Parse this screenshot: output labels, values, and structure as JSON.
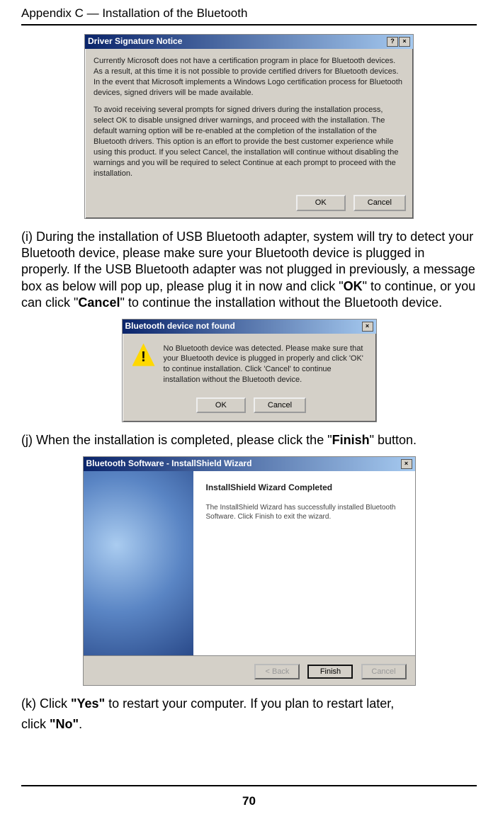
{
  "header": {
    "title": "Appendix C — Installation of the Bluetooth"
  },
  "dialog1": {
    "title": "Driver Signature Notice",
    "p1": "Currently Microsoft does not have a certification program in place for Bluetooth devices. As a result, at this time it is not possible to provide certified drivers for Bluetooth devices. In the event that Microsoft implements a Windows Logo certification process for Bluetooth devices, signed drivers will be made available.",
    "p2": "To avoid receiving several prompts for signed drivers during the installation process, select OK to disable unsigned driver warnings, and proceed with the installation. The default warning option will be re-enabled at the completion of the installation of the Bluetooth drivers. This option is an effort to provide the best customer experience while using this product. If you select Cancel, the installation will continue without disabling the warnings and you will be required to select Continue at each prompt to proceed with the installation.",
    "ok": "OK",
    "cancel": "Cancel"
  },
  "para_i": {
    "pre": "(i) During the installation of USB Bluetooth adapter, system will try to detect your Bluetooth device, please make sure your Bluetooth device is plugged in properly. If the USB Bluetooth adapter was not plugged in previously, a message box as below will pop up, please plug it in now and click \"",
    "ok": "OK",
    "mid": "\" to continue, or you can click \"",
    "cancel": "Cancel",
    "post": "\" to continue the installation without the Bluetooth device."
  },
  "dialog2": {
    "title": "Bluetooth device not found",
    "msg": "No Bluetooth device was detected. Please make sure that your Bluetooth device is plugged in properly and click 'OK' to continue installation. Click 'Cancel' to continue installation without the Bluetooth device.",
    "ok": "OK",
    "cancel": "Cancel"
  },
  "para_j": {
    "pre": "(j) When the installation is completed, please click the \"",
    "finish": "Finish",
    "post": "\" button."
  },
  "dialog3": {
    "title": "Bluetooth Software - InstallShield Wizard",
    "heading": "InstallShield Wizard Completed",
    "msg": "The InstallShield Wizard has successfully installed Bluetooth Software. Click Finish to exit the wizard.",
    "back": "< Back",
    "finish": "Finish",
    "cancel": "Cancel"
  },
  "para_k": {
    "pre": "(k) Click ",
    "yes": "\"Yes\"",
    "mid": " to restart your computer. If you plan to restart later,",
    "line2_pre": "click ",
    "no": "\"No\"",
    "line2_post": "."
  },
  "footer": {
    "page": "70"
  }
}
